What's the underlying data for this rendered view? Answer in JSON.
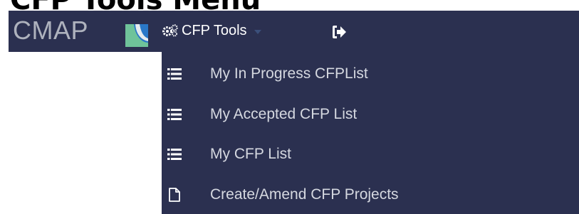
{
  "page_title": "CFP Tools Menu",
  "navbar": {
    "brand": "CMAP",
    "tools_label": "CFP Tools",
    "background_color": "#2b3050"
  },
  "menu": {
    "items": [
      {
        "label": "My In Progress CFPList",
        "icon": "list-icon"
      },
      {
        "label": "My Accepted CFP List",
        "icon": "list-icon"
      },
      {
        "label": "My CFP List",
        "icon": "list-icon"
      },
      {
        "label": "Create/Amend CFP Projects",
        "icon": "file-icon"
      }
    ]
  }
}
